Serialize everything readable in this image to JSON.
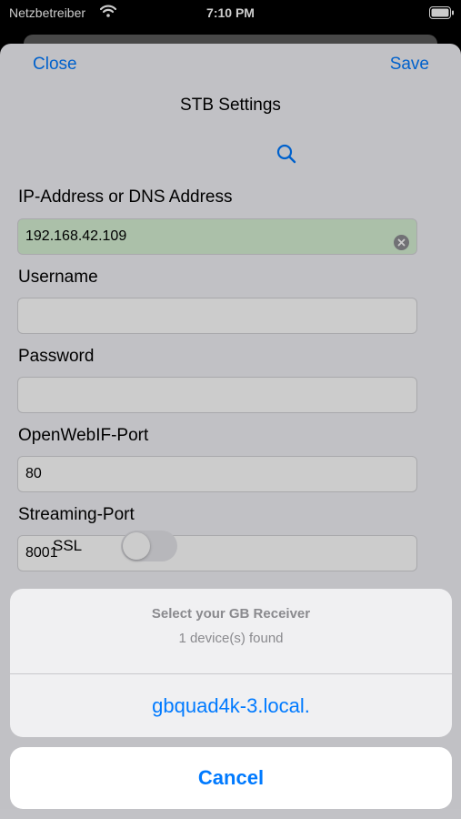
{
  "status_bar": {
    "carrier": "Netzbetreiber",
    "time": "7:10 PM"
  },
  "nav": {
    "close_label": "Close",
    "save_label": "Save",
    "title": "STB Settings"
  },
  "form": {
    "ip_label": "IP-Address or DNS Address",
    "ip_value": "192.168.42.109",
    "username_label": "Username",
    "username_value": "",
    "password_label": "Password",
    "password_value": "",
    "webif_port_label": "OpenWebIF-Port",
    "webif_port_value": "80",
    "streaming_port_label": "Streaming-Port",
    "streaming_port_value": "8001",
    "ssl_label": "SSL",
    "ssl_enabled": false
  },
  "action_sheet": {
    "title": "Select your GB Receiver",
    "message": "1 device(s) found",
    "options": [
      "gbquad4k-3.local."
    ],
    "cancel_label": "Cancel"
  },
  "colors": {
    "accent": "#007aff",
    "valid_field": "#d6f0d4"
  }
}
